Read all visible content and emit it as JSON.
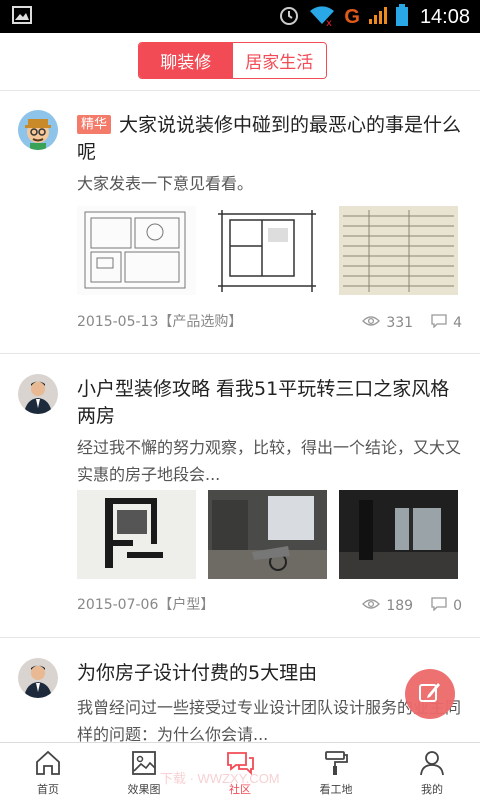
{
  "status_bar": {
    "time": "14:08",
    "carrier": "G"
  },
  "header": {
    "tabs": [
      {
        "label": "聊装修",
        "active": true
      },
      {
        "label": "居家生活",
        "active": false
      }
    ],
    "accent": "#f24b55"
  },
  "posts": [
    {
      "badge": "精华",
      "title": "大家说说装修中碰到的最恶心的事是什么呢",
      "desc": "大家发表一下意见看看。",
      "date": "2015-05-13",
      "tag": "【产品选购】",
      "views": "331",
      "comments": "4"
    },
    {
      "title": "小户型装修攻略 看我51平玩转三口之家风格两房",
      "desc": "经过我不懈的努力观察，比较，得出一个结论，又大又实惠的房子地段会...",
      "date": "2015-07-06",
      "tag": "【户型】",
      "views": "189",
      "comments": "0"
    },
    {
      "title": "为你房子设计付费的5大理由",
      "desc": "我曾经问过一些接受过专业设计团队设计服务的业主同样的问题：为什么你会请..."
    }
  ],
  "tabbar": [
    {
      "label": "首页",
      "icon": "home-icon"
    },
    {
      "label": "效果图",
      "icon": "image-icon"
    },
    {
      "label": "社区",
      "icon": "chat-icon",
      "active": true
    },
    {
      "label": "看工地",
      "icon": "paint-roller-icon"
    },
    {
      "label": "我的",
      "icon": "person-icon"
    }
  ],
  "watermark": "下载 · WWZXY.COM"
}
